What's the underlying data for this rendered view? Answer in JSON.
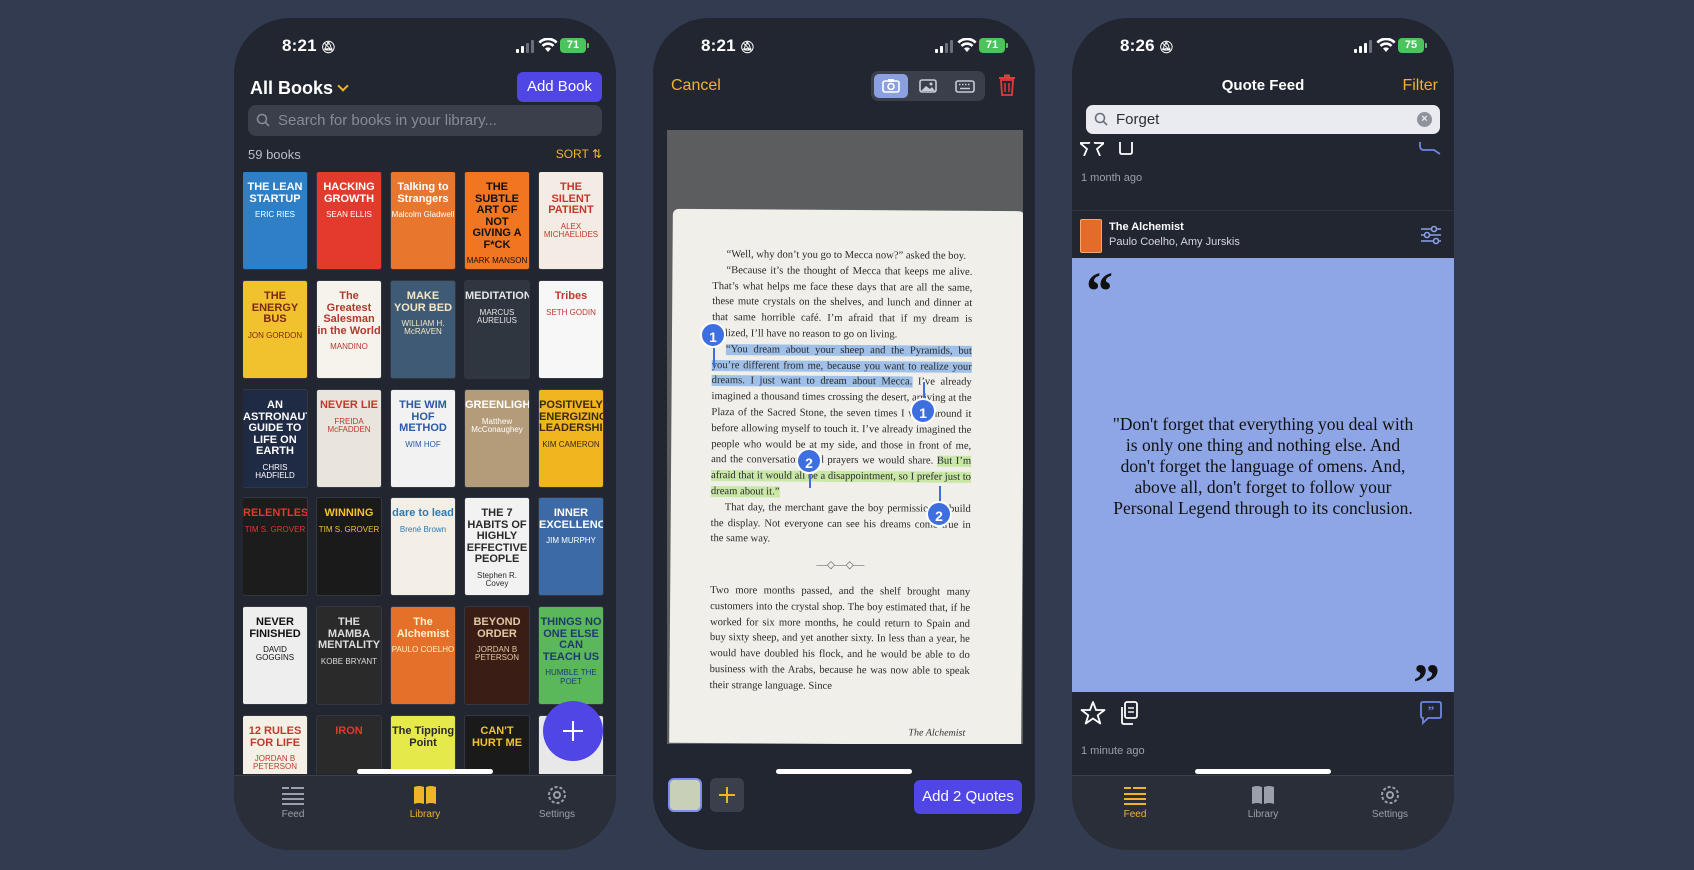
{
  "phone1": {
    "status": {
      "time": "8:21",
      "battery": "71"
    },
    "header": {
      "title": "All Books",
      "add_label": "Add Book"
    },
    "search": {
      "placeholder": "Search for books in your library..."
    },
    "count": "59 books",
    "sort_label": "SORT",
    "books": [
      {
        "title": "THE LEAN STARTUP",
        "sub": "ERIC RIES",
        "bg": "#2f7fc7",
        "fg": "#ffffff"
      },
      {
        "title": "HACKING GROWTH",
        "sub": "SEAN ELLIS",
        "bg": "#e23b2e",
        "fg": "#ffffff"
      },
      {
        "title": "Talking to Strangers",
        "sub": "Malcolm Gladwell",
        "bg": "#e8762c",
        "fg": "#ffffff"
      },
      {
        "title": "THE SUBTLE ART OF NOT GIVING A F*CK",
        "sub": "MARK MANSON",
        "bg": "#f27521",
        "fg": "#111111"
      },
      {
        "title": "THE SILENT PATIENT",
        "sub": "ALEX MICHAELIDES",
        "bg": "#f4ece4",
        "fg": "#c0392b"
      },
      {
        "title": "THE ENERGY BUS",
        "sub": "JON GORDON",
        "bg": "#f2c12e",
        "fg": "#7a2a10"
      },
      {
        "title": "The Greatest Salesman in the World",
        "sub": "MANDINO",
        "bg": "#f6f3ec",
        "fg": "#b03a2e"
      },
      {
        "title": "MAKE YOUR BED",
        "sub": "WILLIAM H. McRAVEN",
        "bg": "#3f5a75",
        "fg": "#f3e7c8"
      },
      {
        "title": "MEDITATIONS",
        "sub": "MARCUS AURELIUS",
        "bg": "#2f3640",
        "fg": "#e6e6e6"
      },
      {
        "title": "Tribes",
        "sub": "SETH GODIN",
        "bg": "#f7f7f7",
        "fg": "#c0392b"
      },
      {
        "title": "AN ASTRONAUT'S GUIDE TO LIFE ON EARTH",
        "sub": "CHRIS HADFIELD",
        "bg": "#1f2a44",
        "fg": "#ffffff"
      },
      {
        "title": "NEVER LIE",
        "sub": "FREIDA McFADDEN",
        "bg": "#e9e4dc",
        "fg": "#c0392b"
      },
      {
        "title": "THE WIM HOF METHOD",
        "sub": "WIM HOF",
        "bg": "#f2f2f2",
        "fg": "#2a5aa0"
      },
      {
        "title": "GREENLIGHTS",
        "sub": "Matthew McConaughey",
        "bg": "#b49b7a",
        "fg": "#ffffff"
      },
      {
        "title": "POSITIVELY ENERGIZING LEADERSHIP",
        "sub": "KIM CAMERON",
        "bg": "#f0b51f",
        "fg": "#3a2a12"
      },
      {
        "title": "RELENTLESS",
        "sub": "TIM S. GROVER",
        "bg": "#1c1c1c",
        "fg": "#e03a2f"
      },
      {
        "title": "WINNING",
        "sub": "TIM S. GROVER",
        "bg": "#1a1a1a",
        "fg": "#f1c232"
      },
      {
        "title": "dare to lead",
        "sub": "Brené Brown",
        "bg": "#f3efe7",
        "fg": "#2a7ab5"
      },
      {
        "title": "THE 7 HABITS OF HIGHLY EFFECTIVE PEOPLE",
        "sub": "Stephen R. Covey",
        "bg": "#f2f2f2",
        "fg": "#2a2a2a"
      },
      {
        "title": "INNER EXCELLENCE",
        "sub": "JIM MURPHY",
        "bg": "#3c6aa6",
        "fg": "#ffffff"
      },
      {
        "title": "NEVER FINISHED",
        "sub": "DAVID GOGGINS",
        "bg": "#eeeeee",
        "fg": "#111111"
      },
      {
        "title": "THE MAMBA MENTALITY",
        "sub": "KOBE BRYANT",
        "bg": "#2a2a2a",
        "fg": "#dddddd"
      },
      {
        "title": "The Alchemist",
        "sub": "PAULO COELHO",
        "bg": "#e5702a",
        "fg": "#fff3c8"
      },
      {
        "title": "BEYOND ORDER",
        "sub": "JORDAN B PETERSON",
        "bg": "#3a1e16",
        "fg": "#e5c8a0"
      },
      {
        "title": "THINGS NO ONE ELSE CAN TEACH US",
        "sub": "HUMBLE THE POET",
        "bg": "#5bb85a",
        "fg": "#1f3a6a"
      },
      {
        "title": "12 RULES FOR LIFE",
        "sub": "JORDAN B PETERSON",
        "bg": "#f4f0e6",
        "fg": "#c0392b"
      },
      {
        "title": "IRON",
        "sub": "",
        "bg": "#2a2a2a",
        "fg": "#e03a2f"
      },
      {
        "title": "The Tipping Point",
        "sub": "",
        "bg": "#e6e94a",
        "fg": "#2a2a2a"
      },
      {
        "title": "CAN'T HURT ME",
        "sub": "",
        "bg": "#1a1a1a",
        "fg": "#f1c232"
      },
      {
        "title": "",
        "sub": "",
        "bg": "#e8e8e8",
        "fg": "#222222"
      }
    ],
    "tabs": [
      {
        "label": "Feed"
      },
      {
        "label": "Library"
      },
      {
        "label": "Settings"
      }
    ]
  },
  "phone2": {
    "status": {
      "time": "8:21",
      "battery": "71"
    },
    "cancel_label": "Cancel",
    "page_lines": [
      {
        "text": "“Well, why don’t you go to Mecca now?” asked the boy.",
        "hl": ""
      },
      {
        "text": "“Because it’s the thought of Mecca that keeps me alive. That’s what helps me face these days that are all the same, these mute crystals on the shelves, and lunch and dinner at that same horrible café. I’m afraid that if my dream is realized, I’ll have no reason to go on living.",
        "hl": ""
      },
      {
        "text": "“You dream about your sheep and the Pyramids, but you’re different from me, because you want to realize your dreams. I just want to dream about Mecca.",
        "hl": "blue"
      },
      {
        "text": "I’ve already imagined a thousand times crossing the desert, arriving at the Plaza of the Sacred Stone, the seven times I walk around it before allowing myself to touch it. I’ve already imagined the people who would be at my side, and those in front of me, and the conversations and prayers we would share.",
        "hl": ""
      },
      {
        "text": "But I’m afraid that it would all be a disappointment, so I prefer just to dream about it.”",
        "hl": "green"
      },
      {
        "text": "That day, the merchant gave the boy permission to build the display. Not everyone can see his dreams come true in the same way.",
        "hl": ""
      }
    ],
    "page_lines_2": "Two more months passed, and the shelf brought many customers into the crystal shop. The boy estimated that, if he worked for six more months, he could return to Spain and buy sixty sheep, and yet another sixty. In less than a year, he would have doubled his flock, and he would be able to do business with the Arabs, because he was now able to speak their strange language. Since",
    "ornament": "—◇—◇—",
    "footer_text": "The Alchemist",
    "markers": [
      "1",
      "1",
      "2",
      "2"
    ],
    "add_quotes_label": "Add 2 Quotes"
  },
  "phone3": {
    "status": {
      "time": "8:26",
      "battery": "75"
    },
    "title": "Quote Feed",
    "filter_label": "Filter",
    "search_value": "Forget",
    "prev_ago": "1 month ago",
    "book_title": "The Alchemist",
    "authors": "Paulo Coelho, Amy Jurskis",
    "quote": "\"Don't forget that everything you deal with is only one thing and nothing else. And don't forget the language of omens. And, above all, don't forget to follow your Personal Legend through to its conclusion.",
    "ago": "1 minute ago",
    "quote_open": "“",
    "quote_close": "”",
    "card_color": "#8fa6e6",
    "tabs": [
      {
        "label": "Feed"
      },
      {
        "label": "Library"
      },
      {
        "label": "Settings"
      }
    ]
  },
  "colors": {
    "accent": "#f0b429",
    "primary": "#4f46e5"
  }
}
